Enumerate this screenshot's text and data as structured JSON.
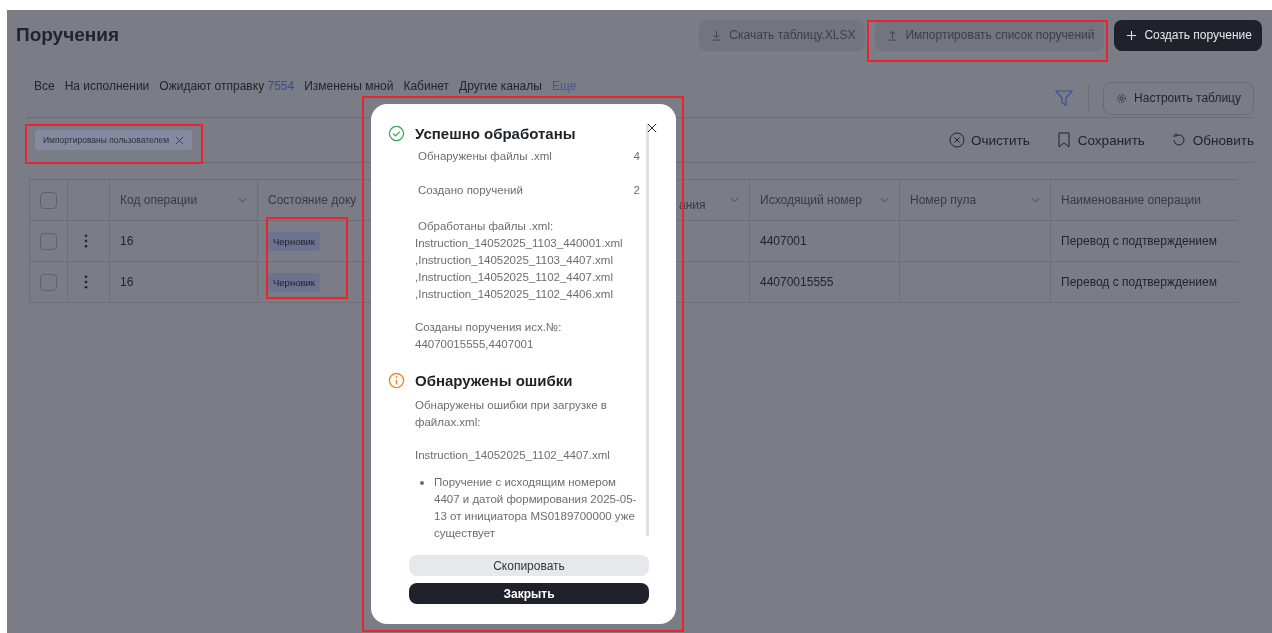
{
  "page": {
    "title": "Поручения"
  },
  "header_buttons": [
    {
      "kind": "download",
      "label": "Скачать таблицу.XLSX"
    },
    {
      "kind": "import",
      "label": "Импортировать список поручений"
    },
    {
      "kind": "create",
      "label": "Создать поручение"
    }
  ],
  "tabs": [
    {
      "label": "Все",
      "selected": false
    },
    {
      "label": "На исполнении",
      "selected": false
    },
    {
      "label": "Ожидают отправку",
      "count": "7554",
      "selected": false
    },
    {
      "label": "Изменены мной",
      "selected": false
    },
    {
      "label": "Кабинет",
      "selected": false
    },
    {
      "label": "Другие каналы",
      "selected": false
    }
  ],
  "more_tab": {
    "label": "Еще"
  },
  "settings_button": {
    "label": "Настроить таблицу"
  },
  "filter_chips": [
    {
      "label": "Импортированы пользователем"
    }
  ],
  "actions": [
    {
      "kind": "clear",
      "label": "Очистить"
    },
    {
      "kind": "save",
      "label": "Сохранить"
    },
    {
      "kind": "refresh",
      "label": "Обновить"
    }
  ],
  "table": {
    "select_all": {
      "checked": false
    },
    "columns": [
      {
        "label": "Код операции",
        "sort": true
      },
      {
        "label": "Состояние доку"
      },
      {
        "label": "ания",
        "sort": true
      },
      {
        "label": "Исходящий номер",
        "sort": true
      },
      {
        "label": "Номер пула",
        "sort": true
      },
      {
        "label": "Наименование операции",
        "sort": false
      }
    ],
    "rows": [
      {
        "checked": false,
        "code": "16",
        "status": "Черновик",
        "outgoing": "4407001",
        "name": "Перевод с подтверждением"
      },
      {
        "checked": false,
        "code": "16",
        "status": "Черновик",
        "outgoing": "44070015555",
        "name": "Перевод с подтверждением"
      }
    ]
  },
  "dialog": {
    "sections": [
      {
        "kind": "success",
        "title": "Успешно обработаны",
        "stats": [
          {
            "label": "Обнаружены файлы .xml",
            "value": "4"
          },
          {
            "label": "Создано поручений",
            "value": "2"
          }
        ],
        "paragraphs": [
          [
            "Обработаны файлы .xml:",
            "Instruction_14052025_1103_440001.xml",
            ",Instruction_14052025_1103_4407.xml",
            ",Instruction_14052025_1102_4407.xml",
            ",Instruction_14052025_1102_4406.xml"
          ],
          [
            "Созданы поручения исх.№:",
            "44070015555,4407001"
          ]
        ]
      },
      {
        "kind": "error",
        "title": "Обнаружены ошибки",
        "paragraphs": [
          [
            "Обнаружены ошибки при загрузке в файлах.xml:"
          ],
          [
            "Instruction_14052025_1102_4407.xml"
          ]
        ],
        "bullets": [
          "Поручение с исходящим номером 4407 и датой формирования 2025-05-13 от инициатора MS0189700000 уже существует"
        ]
      }
    ],
    "buttons": [
      {
        "kind": "secondary",
        "label": "Скопировать"
      },
      {
        "kind": "primary",
        "label": "Закрыть"
      }
    ]
  }
}
